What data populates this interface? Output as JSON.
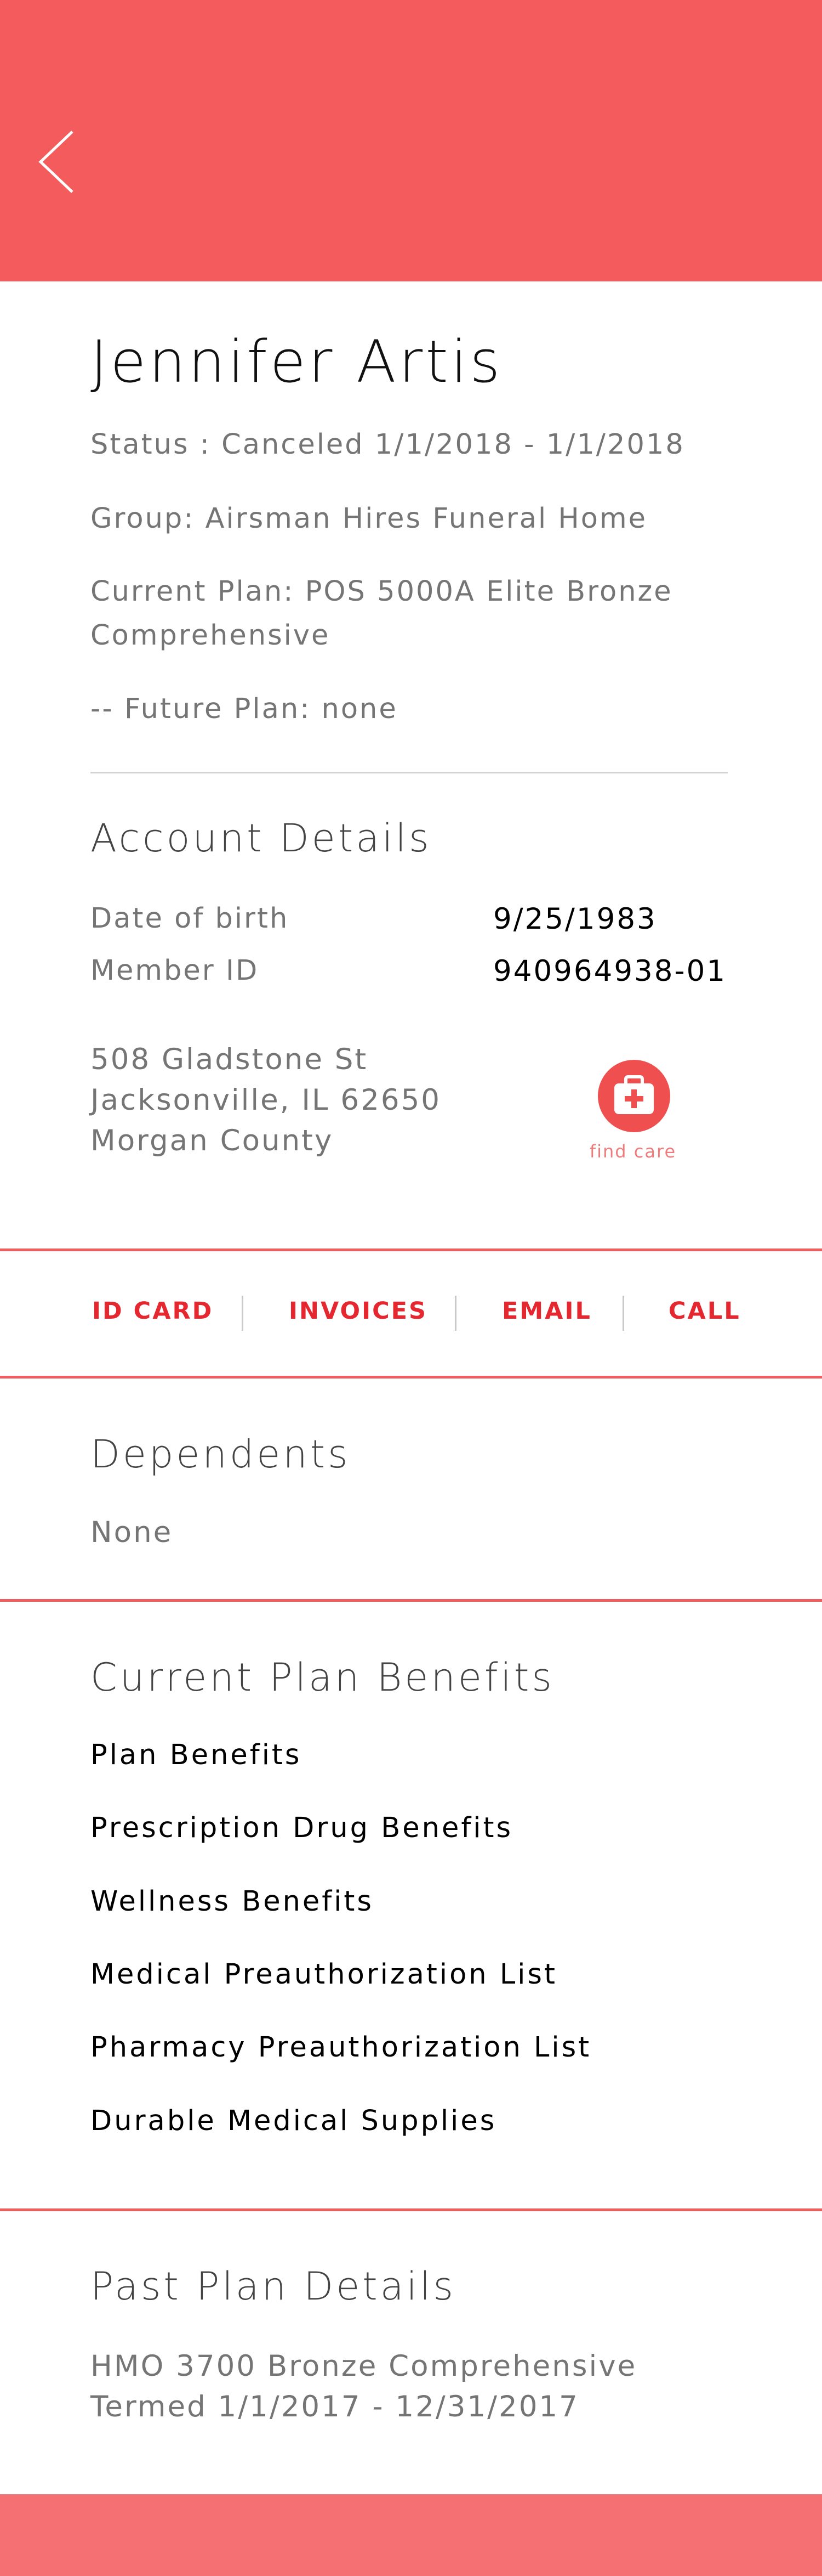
{
  "header": {
    "back_icon": "chevron-left-icon",
    "color": "#f35b5d"
  },
  "member": {
    "name": "Jennifer Artis",
    "status": "Status : Canceled 1/1/2018 - 1/1/2018",
    "group": "Group: Airsman Hires Funeral Home",
    "current_plan_line1": "Current Plan: POS 5000A Elite Bronze",
    "current_plan_line2": "Comprehensive",
    "future_plan": "-- Future Plan: none"
  },
  "account": {
    "title": "Account Details",
    "dob_label": "Date of birth",
    "dob_value": "9/25/1983",
    "member_id_label": "Member ID",
    "member_id_value": "940964938-01",
    "address_line1": "508 Gladstone St",
    "address_line2": "Jacksonville, IL 62650",
    "address_line3": "Morgan County",
    "find_care_icon": "first-aid-kit-icon",
    "find_care_label": "find care"
  },
  "actions": {
    "id_card": "ID CARD",
    "invoices": "INVOICES",
    "email": "EMAIL",
    "call": "CALL",
    "color": "#e5282f"
  },
  "dependents": {
    "title": "Dependents",
    "value": "None"
  },
  "benefits": {
    "title": "Current Plan Benefits",
    "items": [
      "Plan Benefits",
      "Prescription Drug Benefits",
      "Wellness Benefits",
      "Medical Preauthorization List",
      "Pharmacy Preauthorization List",
      "Durable Medical Supplies"
    ]
  },
  "past_plan": {
    "title": "Past Plan Details",
    "line1": "HMO 3700 Bronze Comprehensive",
    "line2": "Termed 1/1/2017 - 12/31/2017"
  },
  "footer": {
    "color": "#f47073"
  }
}
